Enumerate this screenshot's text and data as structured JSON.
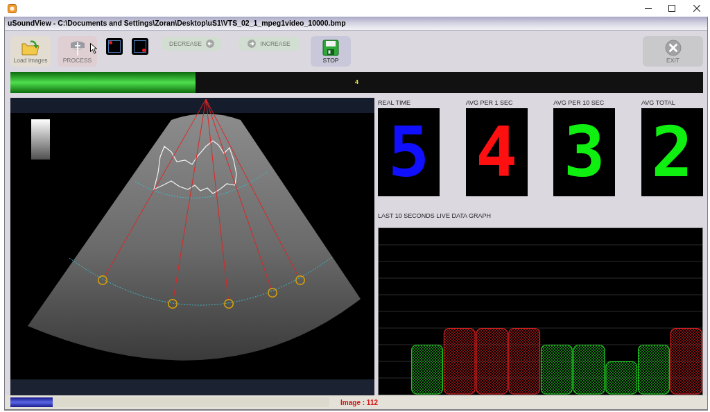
{
  "window": {
    "title": "uSoundView - C:\\Documents and Settings\\Zoran\\Desktop\\uS1\\VTS_02_1_mpeg1video_10000.bmp"
  },
  "toolbar": {
    "left": [
      {
        "kind": "tile",
        "label": "Load Images",
        "disabled": true
      },
      {
        "kind": "tile",
        "label": "PROCESS",
        "disabled": true
      },
      {
        "kind": "toggle"
      },
      {
        "kind": "toggle"
      },
      {
        "kind": "pill",
        "label": "DECREASE",
        "disabled": true
      },
      {
        "kind": "pill",
        "label": "INCREASE",
        "disabled": true
      },
      {
        "kind": "tile",
        "label": "STOP",
        "disabled": false
      }
    ],
    "right": [
      {
        "kind": "tile",
        "label": "EXIT",
        "disabled": true
      }
    ]
  },
  "progress": {
    "level": 0.267,
    "label": "4"
  },
  "meters": [
    {
      "title": "REAL TIME",
      "value": "5",
      "color": "#1010ff"
    },
    {
      "title": "AVG PER 1 SEC",
      "value": "4",
      "color": "#ff1010"
    },
    {
      "title": "AVG PER 10 SEC",
      "value": "3",
      "color": "#10f010"
    },
    {
      "title": "AVG TOTAL",
      "value": "2",
      "color": "#10f010"
    }
  ],
  "graph": {
    "title": "LAST 10 SECONDS LIVE DATA GRAPH"
  },
  "status_bar": {
    "level": 0.133,
    "text": "Image : 112"
  }
}
